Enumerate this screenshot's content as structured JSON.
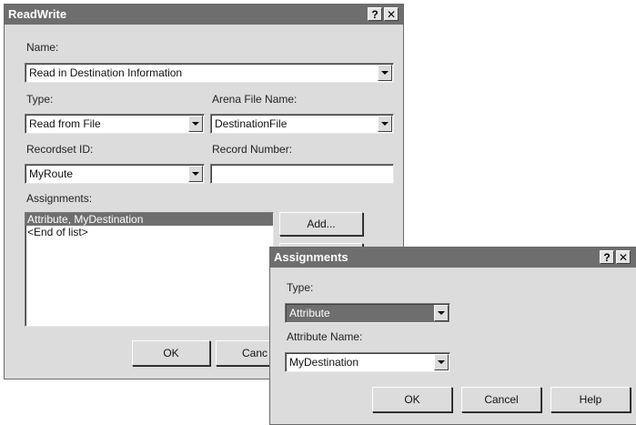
{
  "readwrite": {
    "title": "ReadWrite",
    "help_glyph": "?",
    "close_glyph": "✕",
    "name_label": "Name:",
    "name_value": "Read in Destination Information",
    "type_label": "Type:",
    "type_value": "Read from File",
    "arena_file_label": "Arena File Name:",
    "arena_file_value": "DestinationFile",
    "recordset_label": "Recordset ID:",
    "recordset_value": "MyRoute",
    "record_number_label": "Record Number:",
    "record_number_value": "",
    "assignments_label": "Assignments:",
    "assignments_items": [
      "Attribute, MyDestination",
      "<End of list>"
    ],
    "add_button": "Add...",
    "ok_button": "OK",
    "cancel_button": "Canc"
  },
  "assignments_dialog": {
    "title": "Assignments",
    "help_glyph": "?",
    "close_glyph": "✕",
    "type_label": "Type:",
    "type_value": "Attribute",
    "attr_name_label": "Attribute Name:",
    "attr_name_value": "MyDestination",
    "ok_button": "OK",
    "cancel_button": "Cancel",
    "help_button": "Help"
  }
}
